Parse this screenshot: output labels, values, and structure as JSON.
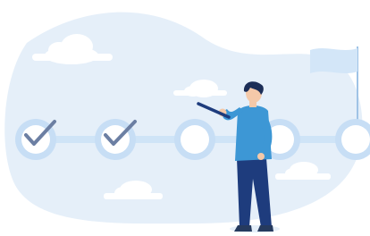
{
  "illustration": {
    "subject": "progress-milestones",
    "milestones_total": 5,
    "milestones_completed": 2,
    "colors": {
      "background_blob": "#e5eff9",
      "cloud": "#ffffff",
      "track": "#cfe4f7",
      "circle_ring": "#c7def5",
      "check": "#6c7fa3",
      "flag": "#d3e6f8",
      "shirt": "#3d97d5",
      "pants": "#1e3c7d",
      "hair": "#1c2e57",
      "skin": "#f4c9a9",
      "shoes": "#263a5e",
      "pencil": "#1e3c7d"
    },
    "icons": [
      "check-icon",
      "flag-icon",
      "pencil-icon"
    ]
  }
}
